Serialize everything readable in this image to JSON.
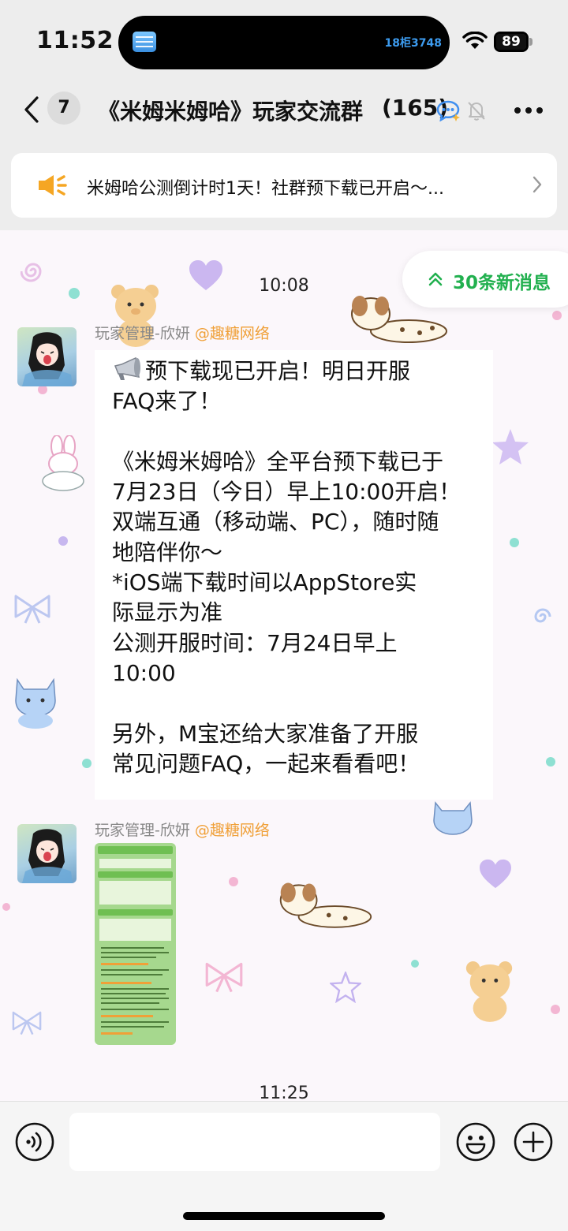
{
  "status_bar": {
    "time": "11:52",
    "island_text": "18柜3748",
    "battery": "89"
  },
  "nav": {
    "unread_count": "7",
    "title": "《米姆米姆哈》玩家交流群",
    "member_count": "(165)"
  },
  "announcement": {
    "text": "米姆哈公测倒计时1天！社群预下载已开启～..."
  },
  "chat": {
    "new_messages_label": "30条新消息",
    "timestamp_1": "10:08",
    "timestamp_2": "11:25",
    "messages": [
      {
        "sender": "玩家管理-欣妍",
        "org": "@趣糖网络",
        "lines": [
          "预下载现已开启！明日开服",
          "FAQ来了！",
          "",
          "《米姆米姆哈》全平台预下载已于",
          "7月23日（今日）早上10:00开启！",
          "双端互通（移动端、PC），随时随",
          "地陪伴你～",
          "*iOS端下载时间以AppStore实",
          "际显示为准",
          "公测开服时间：7月24日早上",
          "10:00",
          "",
          "另外，M宝还给大家准备了开服",
          "常见问题FAQ，一起来看看吧！"
        ]
      },
      {
        "sender": "玩家管理-欣妍",
        "org": "@趣糖网络",
        "type": "image"
      }
    ]
  },
  "input": {
    "placeholder": ""
  },
  "colors": {
    "accent_green": "#22b04f",
    "org_orange": "#f0a038",
    "sender_gray": "#888888"
  }
}
